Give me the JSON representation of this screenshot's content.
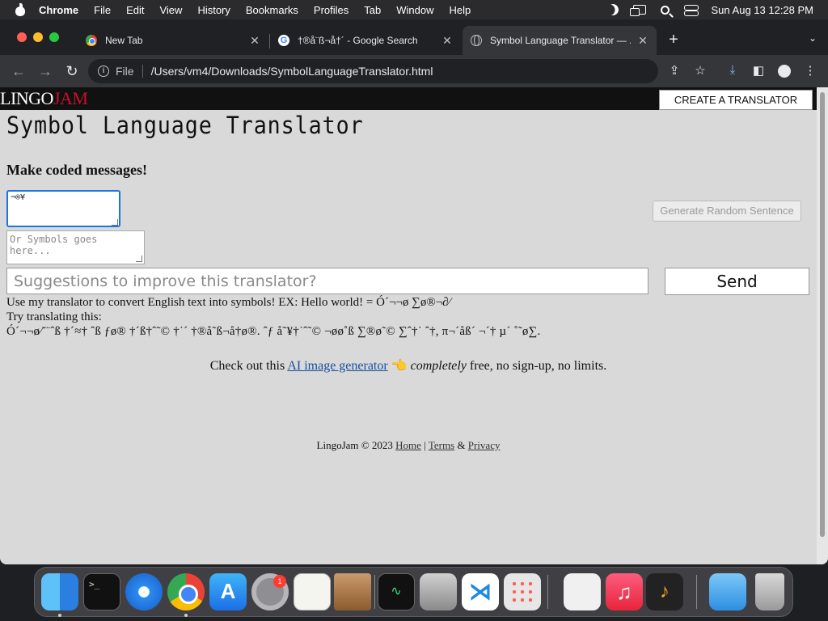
{
  "menubar": {
    "app": "Chrome",
    "items": [
      "File",
      "Edit",
      "View",
      "History",
      "Bookmarks",
      "Profiles",
      "Tab",
      "Window",
      "Help"
    ],
    "clock": "Sun Aug 13  12:28 PM"
  },
  "tabs": [
    {
      "title": "New Tab",
      "icon": "chrome-icon"
    },
    {
      "title": "†®å¨ß¬å†´ - Google Search",
      "icon": "google-icon"
    },
    {
      "title": "Symbol Language Translator — ...",
      "icon": "globe-icon"
    }
  ],
  "omnibox": {
    "scheme": "File",
    "path": "/Users/vm4/Downloads/SymbolLanguageTranslator.html"
  },
  "site": {
    "logo_main": "LINGO",
    "logo_accent": "JAM",
    "create_button": "CREATE A TRANSLATOR"
  },
  "page": {
    "title": "Symbol Language Translator",
    "subtitle": "Make coded messages!",
    "english_input_value": "¬®¥",
    "symbols_placeholder": "Or Symbols goes here...",
    "generate_button": "Generate Random Sentence",
    "suggest_placeholder": "Suggestions to improve this translator?",
    "send_button": "Send",
    "description_line1": "Use my translator to convert English text into symbols! EX: Hello world! = Ó´¬¬ø ∑ø®¬∂⁄",
    "description_line2": "Try translating this:",
    "description_line3": "Ó´¬¬ø⁄˘¨ˆß †´≈† ˆß ƒø® †´ß†ˆ˜© †˙´ †®å˜ß¬å†ø®. ˆƒ å˜¥†˙ˆ˜© ¬øø˚ß ∑®ø˜© ∑ˆ†˙ ˆ†, π¬´åß´ ¬´† µ´ ˚˜ø∑."
  },
  "promo": {
    "prefix": "Check out this",
    "link": "AI image generator",
    "emoji": "👈",
    "emphasis": "completely",
    "suffix": "free, no sign-up, no limits."
  },
  "footer": {
    "copyright": "LingoJam © 2023",
    "home": "Home",
    "sep1": "|",
    "terms": "Terms",
    "amp": "&",
    "privacy": "Privacy"
  },
  "dock": {
    "apps": [
      "Finder",
      "Terminal",
      "Safari",
      "Chrome",
      "App Store",
      "System Settings",
      "TextEdit",
      "Archive Utility",
      "Activity Monitor",
      "Migration Assistant",
      "Visual Studio Code",
      "Launchpad",
      "System Information",
      "Music",
      "GarageBand",
      "Downloads",
      "Trash"
    ],
    "settings_badge": "1"
  },
  "colors": {
    "page_bg": "#d9d9d9",
    "header_bg": "#111111",
    "logo_accent": "#c8102e",
    "focus_ring": "#1a73e8",
    "link": "#1a4fa0"
  }
}
